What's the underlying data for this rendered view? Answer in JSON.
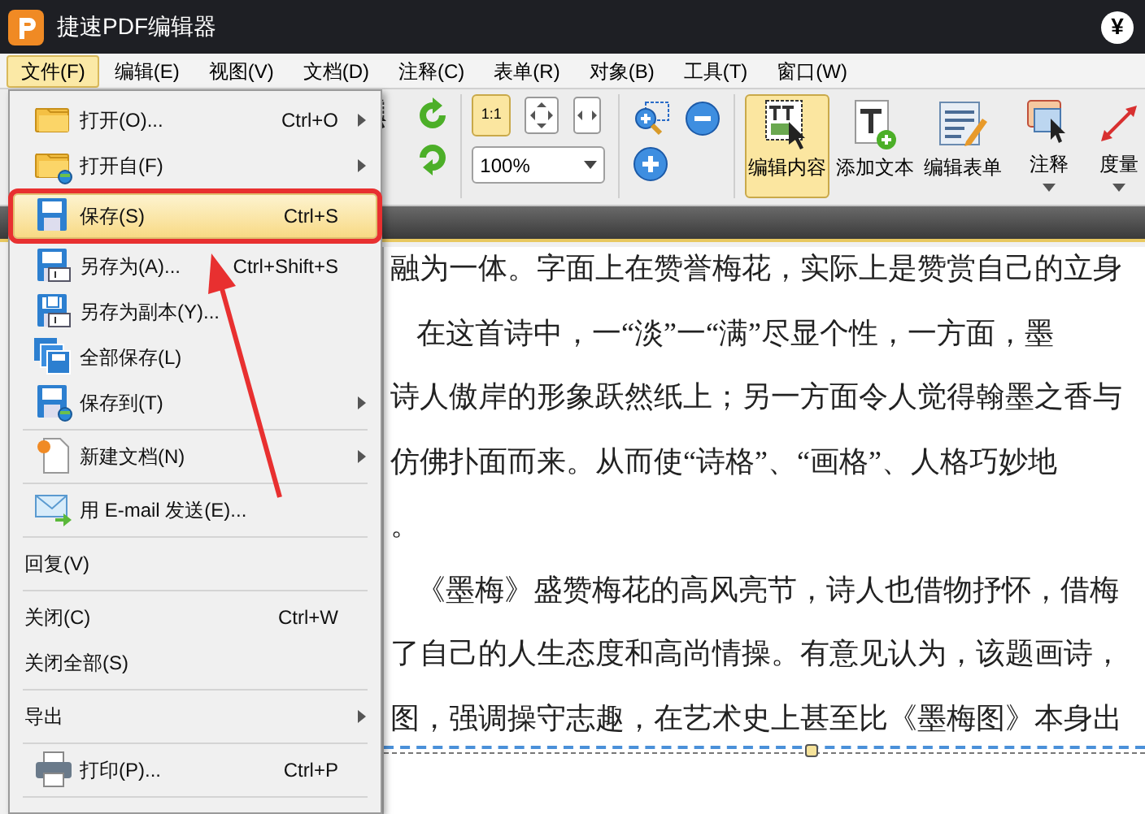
{
  "window": {
    "title": "捷速PDF编辑器",
    "currency_button": "¥"
  },
  "menubar": [
    {
      "label": "文件(F)",
      "selected": true
    },
    {
      "label": "编辑(E)",
      "selected": false
    },
    {
      "label": "视图(V)",
      "selected": false
    },
    {
      "label": "文档(D)",
      "selected": false
    },
    {
      "label": "注释(C)",
      "selected": false
    },
    {
      "label": "表单(R)",
      "selected": false
    },
    {
      "label": "对象(B)",
      "selected": false
    },
    {
      "label": "工具(T)",
      "selected": false
    },
    {
      "label": "窗口(W)",
      "selected": false
    }
  ],
  "toolbar": {
    "actual_size": {
      "label": "1:1",
      "selected": true
    },
    "zoom": "100%",
    "tools": [
      {
        "label": "编辑内容",
        "selected": true,
        "dropdown": false
      },
      {
        "label": "添加文本",
        "selected": false,
        "dropdown": false
      },
      {
        "label": "编辑表单",
        "selected": false,
        "dropdown": false
      },
      {
        "label": "注释",
        "selected": false,
        "dropdown": true
      },
      {
        "label": "度量",
        "selected": false,
        "dropdown": true
      }
    ]
  },
  "file_menu": [
    {
      "kind": "item",
      "label": "打开(O)...",
      "shortcut": "Ctrl+O",
      "submenu": true,
      "selected": false
    },
    {
      "kind": "item",
      "label": "打开自(F)",
      "submenu": true,
      "selected": false
    },
    {
      "kind": "item",
      "label": "保存(S)",
      "shortcut": "Ctrl+S",
      "submenu": false,
      "selected": true,
      "marked": true
    },
    {
      "kind": "item",
      "label": "另存为(A)...",
      "shortcut": "Ctrl+Shift+S",
      "submenu": false,
      "selected": false
    },
    {
      "kind": "item",
      "label": "另存为副本(Y)...",
      "submenu": false,
      "selected": false
    },
    {
      "kind": "item",
      "label": "全部保存(L)",
      "submenu": false,
      "selected": false
    },
    {
      "kind": "item",
      "label": "保存到(T)",
      "submenu": true,
      "selected": false
    },
    {
      "kind": "separator"
    },
    {
      "kind": "item",
      "label": "新建文档(N)",
      "submenu": true,
      "selected": false
    },
    {
      "kind": "separator"
    },
    {
      "kind": "item",
      "label": "用 E-mail 发送(E)...",
      "submenu": false,
      "selected": false
    },
    {
      "kind": "separator"
    },
    {
      "kind": "item",
      "label": "回复(V)",
      "submenu": false,
      "selected": false
    },
    {
      "kind": "separator"
    },
    {
      "kind": "item",
      "label": "关闭(C)",
      "shortcut": "Ctrl+W",
      "submenu": false,
      "selected": false
    },
    {
      "kind": "item",
      "label": "关闭全部(S)",
      "submenu": false,
      "selected": false
    },
    {
      "kind": "separator"
    },
    {
      "kind": "item",
      "label": "导出",
      "submenu": true,
      "selected": false
    },
    {
      "kind": "separator"
    },
    {
      "kind": "item",
      "label": "打印(P)...",
      "shortcut": "Ctrl+P",
      "submenu": false,
      "selected": false
    },
    {
      "kind": "separator"
    }
  ],
  "callout_arrow": true,
  "document": {
    "lines": [
      {
        "text": "融为一体。字面上在赞誉梅花，实际上是赞赏自己的立身",
        "indent": false
      },
      {
        "text": "在这首诗中，一“淡”一“满”尽显个性，一方面，墨",
        "indent": true
      },
      {
        "text": "诗人傲岸的形象跃然纸上；另一方面令人觉得翰墨之香与",
        "indent": false
      },
      {
        "text": "仿佛扑面而来。从而使“诗格”、“画格”、人格巧妙地",
        "indent": false
      },
      {
        "text": "。",
        "indent": false
      },
      {
        "text": "《墨梅》盛赞梅花的高风亮节，诗人也借物抒怀，借梅",
        "indent": true
      },
      {
        "text": "了自己的人生态度和高尚情操。有意见认为，该题画诗，",
        "indent": false
      },
      {
        "text": "图，强调操守志趣，在艺术史上甚至比《墨梅图》本身出",
        "indent": false
      }
    ]
  }
}
